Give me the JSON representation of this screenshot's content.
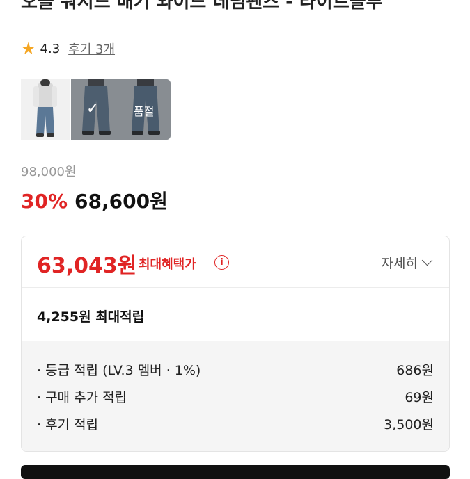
{
  "product": {
    "title": "오블 워시드 배기 와이드 데님팬츠 - 라이트블루"
  },
  "rating": {
    "star_icon": "star-icon",
    "score": "4.3",
    "reviews_label": "후기 3개"
  },
  "thumbnails": {
    "soldout_label": "품절",
    "check_icon": "✓"
  },
  "price": {
    "original": "98,000원",
    "discount": "30%",
    "sale": "68,600원"
  },
  "benefits": {
    "best_price": "63,043원",
    "best_label": "최대혜택가",
    "info_icon": "i",
    "detail_label": "자세히",
    "max_points": "4,255원 최대적립",
    "points": [
      {
        "label": "· 등급 적립 (LV.3 멤버 · 1%)",
        "value": "686원"
      },
      {
        "label": "· 구매 추가 적립",
        "value": "69원"
      },
      {
        "label": "· 후기 적립",
        "value": "3,500원"
      }
    ]
  },
  "colors": {
    "accent_red": "#e02424",
    "star": "#f5a623"
  }
}
